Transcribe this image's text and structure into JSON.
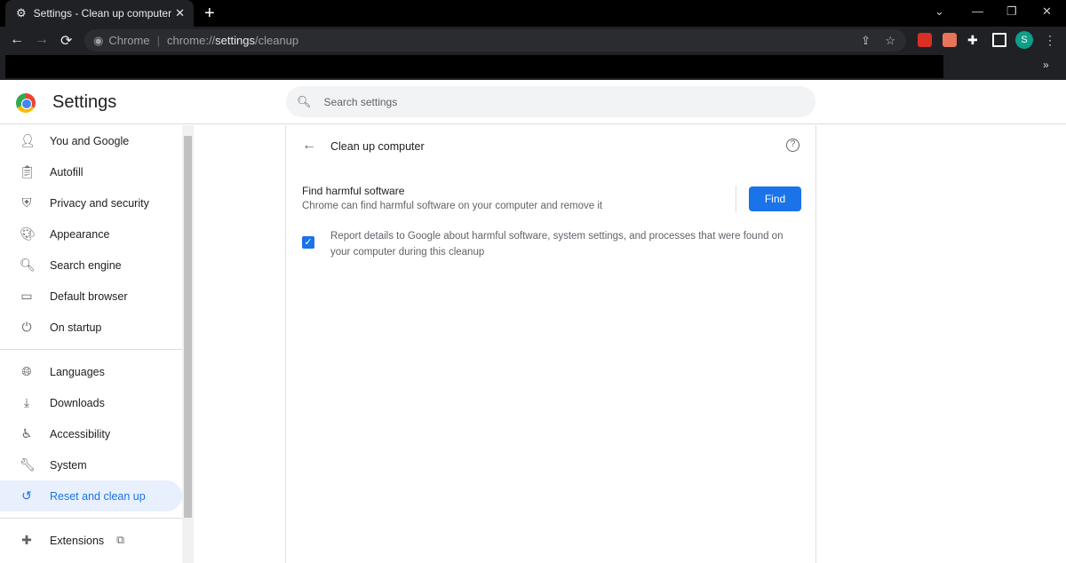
{
  "tab": {
    "title": "Settings - Clean up computer"
  },
  "omnibox": {
    "site": "Chrome",
    "url_prefix": "chrome://",
    "url_bold": "settings",
    "url_suffix": "/cleanup"
  },
  "profile_initial": "S",
  "header": {
    "title": "Settings",
    "search_placeholder": "Search settings"
  },
  "sidebar": {
    "items": [
      {
        "label": "You and Google",
        "icon": "person-icon",
        "glyph": "👤"
      },
      {
        "label": "Autofill",
        "icon": "clipboard-icon",
        "glyph": "📋"
      },
      {
        "label": "Privacy and security",
        "icon": "shield-icon",
        "glyph": "⛨"
      },
      {
        "label": "Appearance",
        "icon": "palette-icon",
        "glyph": "🎨"
      },
      {
        "label": "Search engine",
        "icon": "search-icon",
        "glyph": "🔍"
      },
      {
        "label": "Default browser",
        "icon": "browser-icon",
        "glyph": "▭"
      },
      {
        "label": "On startup",
        "icon": "power-icon",
        "glyph": "⏻"
      },
      {
        "label": "Languages",
        "icon": "globe-icon",
        "glyph": "🌐"
      },
      {
        "label": "Downloads",
        "icon": "download-icon",
        "glyph": "⤓"
      },
      {
        "label": "Accessibility",
        "icon": "accessibility-icon",
        "glyph": "♿"
      },
      {
        "label": "System",
        "icon": "wrench-icon",
        "glyph": "🔧"
      },
      {
        "label": "Reset and clean up",
        "icon": "history-icon",
        "glyph": "↺"
      },
      {
        "label": "Extensions",
        "icon": "puzzle-icon",
        "glyph": "✚"
      }
    ]
  },
  "content": {
    "title": "Clean up computer",
    "find_heading": "Find harmful software",
    "find_desc": "Chrome can find harmful software on your computer and remove it",
    "find_button": "Find",
    "report_label": "Report details to Google about harmful software, system settings, and processes that were found on your computer during this cleanup",
    "report_checked": true
  },
  "colors": {
    "accent": "#1a73e8"
  }
}
